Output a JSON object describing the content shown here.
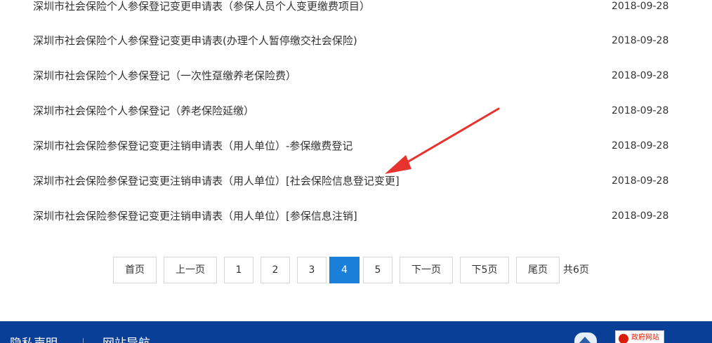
{
  "list": {
    "items": [
      {
        "title": "深圳市社会保险个人参保登记变更申请表（参保人员个人变更缴费项目）",
        "date": "2018-09-28"
      },
      {
        "title": "深圳市社会保险个人参保登记变更申请表(办理个人暂停缴交社会保险)",
        "date": "2018-09-28"
      },
      {
        "title": "深圳市社会保险个人参保登记（一次性趸缴养老保险费）",
        "date": "2018-09-28"
      },
      {
        "title": "深圳市社会保险个人参保登记（养老保险延缴）",
        "date": "2018-09-28"
      },
      {
        "title": "深圳市社会保险参保登记变更注销申请表（用人单位）-参保缴费登记",
        "date": "2018-09-28"
      },
      {
        "title": "深圳市社会保险参保登记变更注销申请表（用人单位）[社会保险信息登记变更]",
        "date": "2018-09-28"
      },
      {
        "title": "深圳市社会保险参保登记变更注销申请表（用人单位）[参保信息注销]",
        "date": "2018-09-28"
      }
    ]
  },
  "pagination": {
    "first": "首页",
    "prev": "上一页",
    "pages": [
      "1",
      "2",
      "3",
      "4",
      "5"
    ],
    "current": "4",
    "next": "下一页",
    "next5": "下5页",
    "last": "尾页",
    "total": "共6页"
  },
  "footer": {
    "privacy": "隐私声明",
    "sitemap": "网站导航",
    "gov_badge_text": "政府网站",
    "background_color": "#0a3f97"
  },
  "annotation": {
    "arrow_color": "#e8322e"
  }
}
